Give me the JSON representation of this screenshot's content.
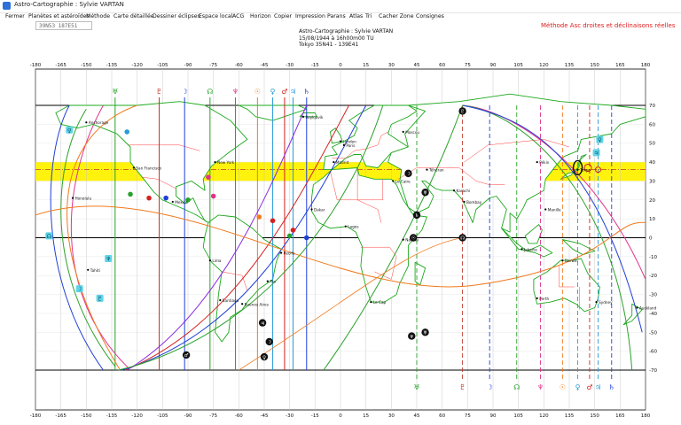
{
  "window": {
    "title": "Astro-Cartographie : Sylvie VARTAN"
  },
  "menu": [
    "Fermer",
    "Planètes et astéroïdes",
    "Méthode",
    "Carte détaillée",
    "Dessiner éclipses",
    "Espace local",
    "ACG",
    "Horizon",
    "Copier",
    "Impression",
    "Parans",
    "Atlas",
    "Tri",
    "Cacher Zone",
    "Consignes"
  ],
  "coords_field": {
    "value": "39N53    187E51"
  },
  "method_label": "Méthode   Asc  droites et déclinaisons réelles",
  "chart_info": {
    "line1": "Astro-Cartographie : Sylvie VARTAN",
    "line2": "15/08/1944 à 16h00m00 TU",
    "line3": "Tokyo 35N41 - 139E41"
  },
  "axes": {
    "lon_ticks": [
      -180,
      -165,
      -150,
      -135,
      -120,
      -105,
      -90,
      -75,
      -60,
      -45,
      -30,
      -15,
      0,
      15,
      30,
      45,
      60,
      75,
      90,
      105,
      120,
      135,
      150,
      165,
      180
    ],
    "lat_ticks": [
      70,
      60,
      50,
      40,
      30,
      20,
      10,
      0,
      -10,
      -20,
      -30,
      -40,
      -50,
      -60,
      -70
    ]
  },
  "highlight_band": {
    "color": "#fff200",
    "lat_from": 30,
    "lat_to": 40
  },
  "colors": {
    "grid": "#000000",
    "coast": "#1da81d",
    "border": "#ff3c3c",
    "band": "#fff200"
  },
  "planet_lines_bottom": [
    {
      "glyph": "♅",
      "lon": 45,
      "color": "#2aa12a"
    },
    {
      "glyph": "♇",
      "lon": 72,
      "color": "#c0392b"
    },
    {
      "glyph": "☽",
      "lon": 88,
      "color": "#1f3fd8"
    },
    {
      "glyph": "☊",
      "lon": 104,
      "color": "#2aa12a"
    },
    {
      "glyph": "♆",
      "lon": 118,
      "color": "#e0338c"
    },
    {
      "glyph": "☉",
      "lon": 131,
      "color": "#f07a1e"
    },
    {
      "glyph": "♀",
      "lon": 140,
      "color": "#2a9bd8"
    },
    {
      "glyph": "♂",
      "lon": 147,
      "color": "#d42121"
    },
    {
      "glyph": "♃",
      "lon": 152,
      "color": "#2a9bd8"
    },
    {
      "glyph": "♄",
      "lon": 160,
      "color": "#1f3fd8"
    }
  ],
  "planet_lines_top": [
    {
      "glyph": "♅",
      "lon": -133,
      "color": "#2aa12a"
    },
    {
      "glyph": "♇",
      "lon": -107,
      "color": "#c0392b"
    },
    {
      "glyph": "☽",
      "lon": -92,
      "color": "#1f3fd8"
    },
    {
      "glyph": "☊",
      "lon": -77,
      "color": "#2aa12a"
    },
    {
      "glyph": "♆",
      "lon": -62,
      "color": "#e0338c"
    },
    {
      "glyph": "☉",
      "lon": -49,
      "color": "#f07a1e"
    },
    {
      "glyph": "♀",
      "lon": -40,
      "color": "#2a9bd8"
    },
    {
      "glyph": "♂",
      "lon": -33,
      "color": "#d42121"
    },
    {
      "glyph": "♃",
      "lon": -28,
      "color": "#2a9bd8"
    },
    {
      "glyph": "♄",
      "lon": -20,
      "color": "#1f3fd8"
    }
  ],
  "cities": [
    {
      "name": "Anchorage",
      "lon": -150,
      "lat": 61
    },
    {
      "name": "Honolulu",
      "lon": -158,
      "lat": 21
    },
    {
      "name": "San Francisco",
      "lon": -122,
      "lat": 37
    },
    {
      "name": "New York",
      "lon": -74,
      "lat": 40
    },
    {
      "name": "Mexico",
      "lon": -99,
      "lat": 19
    },
    {
      "name": "Lima",
      "lon": -77,
      "lat": -12
    },
    {
      "name": "Santiago",
      "lon": -71,
      "lat": -33
    },
    {
      "name": "Buenos Aires",
      "lon": -58,
      "lat": -35
    },
    {
      "name": "Rio",
      "lon": -43,
      "lat": -23
    },
    {
      "name": "Recife",
      "lon": -35,
      "lat": -8
    },
    {
      "name": "Reykjavik",
      "lon": -22,
      "lat": 64
    },
    {
      "name": "London",
      "lon": 0,
      "lat": 51
    },
    {
      "name": "Paris",
      "lon": 2,
      "lat": 49
    },
    {
      "name": "Madrid",
      "lon": -4,
      "lat": 40
    },
    {
      "name": "Dakar",
      "lon": -17,
      "lat": 15
    },
    {
      "name": "Lagos",
      "lon": 3,
      "lat": 6
    },
    {
      "name": "Le Caire",
      "lon": 31,
      "lat": 30
    },
    {
      "name": "Nairobi",
      "lon": 37,
      "lat": -1
    },
    {
      "name": "Le Cap",
      "lon": 18,
      "lat": -34
    },
    {
      "name": "Moscou",
      "lon": 37,
      "lat": 56
    },
    {
      "name": "Téhéran",
      "lon": 51,
      "lat": 36
    },
    {
      "name": "Karachi",
      "lon": 67,
      "lat": 25
    },
    {
      "name": "Bombay",
      "lon": 73,
      "lat": 19
    },
    {
      "name": "Pékin",
      "lon": 116,
      "lat": 40
    },
    {
      "name": "Tokyo",
      "lon": 140,
      "lat": 36
    },
    {
      "name": "Manille",
      "lon": 121,
      "lat": 15
    },
    {
      "name": "Jakarta",
      "lon": 107,
      "lat": -6
    },
    {
      "name": "Darwin",
      "lon": 131,
      "lat": -12
    },
    {
      "name": "Perth",
      "lon": 116,
      "lat": -32
    },
    {
      "name": "Sydney",
      "lon": 151,
      "lat": -34
    },
    {
      "name": "Auckland",
      "lon": 175,
      "lat": -37
    },
    {
      "name": "Tahiti",
      "lon": -149,
      "lat": -17
    }
  ]
}
